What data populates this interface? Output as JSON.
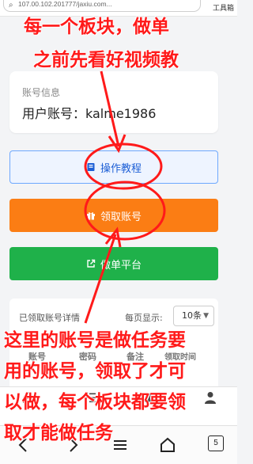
{
  "browser": {
    "url": "107.00.102.201777/jaxiu.com...",
    "toolbox_label": "工具箱"
  },
  "account_card": {
    "label": "账号信息",
    "value": "用户账号：kalme1986"
  },
  "buttons": {
    "tutorial": "操作教程",
    "claim": "领取账号",
    "platform": "做单平台"
  },
  "claimed_panel": {
    "title": "已领取账号详情",
    "per_page_label": "每页显示:",
    "per_page_value": "10条",
    "columns": [
      "账号",
      "密码",
      "备注",
      "领取时间"
    ]
  },
  "annotations": {
    "line1": "每一个板块，做单",
    "line2": "之前先看好视频教",
    "line3": "这里的账号是做任务要",
    "line4": "用的账号，领取了才可",
    "line5": "以做，每个板块都要领",
    "line6": "取才能做任务",
    "color": "#ff1a1a"
  },
  "system_nav": {
    "tab_count": "5"
  }
}
